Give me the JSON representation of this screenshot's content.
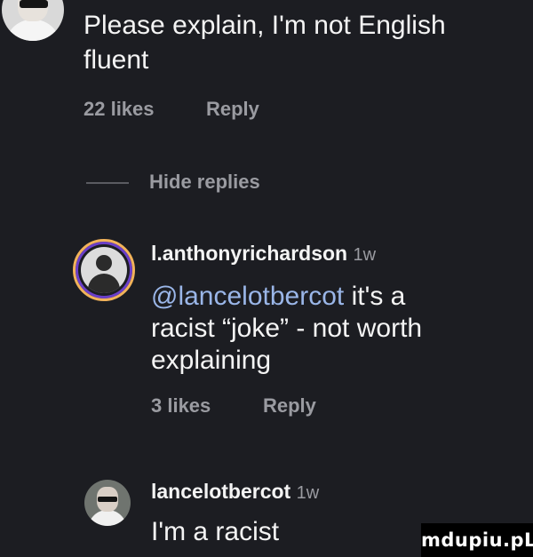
{
  "comments": [
    {
      "body_line1": "Please explain, I'm not English",
      "body_line2": "fluent",
      "likes": "22 likes",
      "reply": "Reply"
    }
  ],
  "thread": {
    "hide_replies": "Hide replies"
  },
  "replies": [
    {
      "username": "l.anthonyrichardson",
      "time": "1w",
      "mention": "@lancelotbercot",
      "body_line1_rest": " it's a",
      "body_line2": "racist “joke” - not worth",
      "body_line3": "explaining",
      "likes": "3 likes",
      "reply": "Reply"
    },
    {
      "username": "lancelotbercot",
      "time": "1w",
      "body_line1": "I'm a racist"
    }
  ],
  "watermark": "mdupiu.pL"
}
